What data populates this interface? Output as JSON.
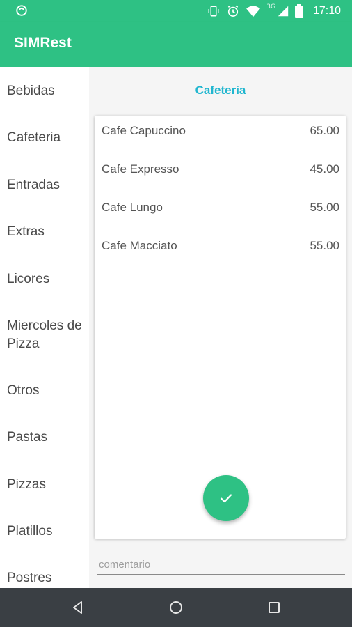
{
  "status_bar": {
    "time": "17:10",
    "network_type": "3G",
    "icons": [
      "sync-icon",
      "vibrate-icon",
      "alarm-icon",
      "wifi-icon",
      "signal-icon",
      "battery-icon"
    ]
  },
  "app": {
    "title": "SIMRest",
    "accent_color": "#2ec184",
    "title_color": "#20b6cf"
  },
  "sidebar": {
    "items": [
      {
        "label": "Bebidas"
      },
      {
        "label": "Cafeteria"
      },
      {
        "label": "Entradas"
      },
      {
        "label": "Extras"
      },
      {
        "label": "Licores"
      },
      {
        "label": "Miercoles de Pizza"
      },
      {
        "label": "Otros"
      },
      {
        "label": "Pastas"
      },
      {
        "label": "Pizzas"
      },
      {
        "label": "Platillos"
      },
      {
        "label": "Postres"
      }
    ]
  },
  "main": {
    "category_title": "Cafeteria",
    "items": [
      {
        "name": "Cafe Capuccino",
        "price": "65.00"
      },
      {
        "name": "Cafe Expresso",
        "price": "45.00"
      },
      {
        "name": "Cafe Lungo",
        "price": "55.00"
      },
      {
        "name": "Cafe Macciato",
        "price": "55.00"
      }
    ],
    "fab_icon": "check-icon",
    "comment_placeholder": "comentario"
  },
  "nav_bar": {
    "icons": [
      "back-icon",
      "home-icon",
      "recents-icon"
    ]
  }
}
